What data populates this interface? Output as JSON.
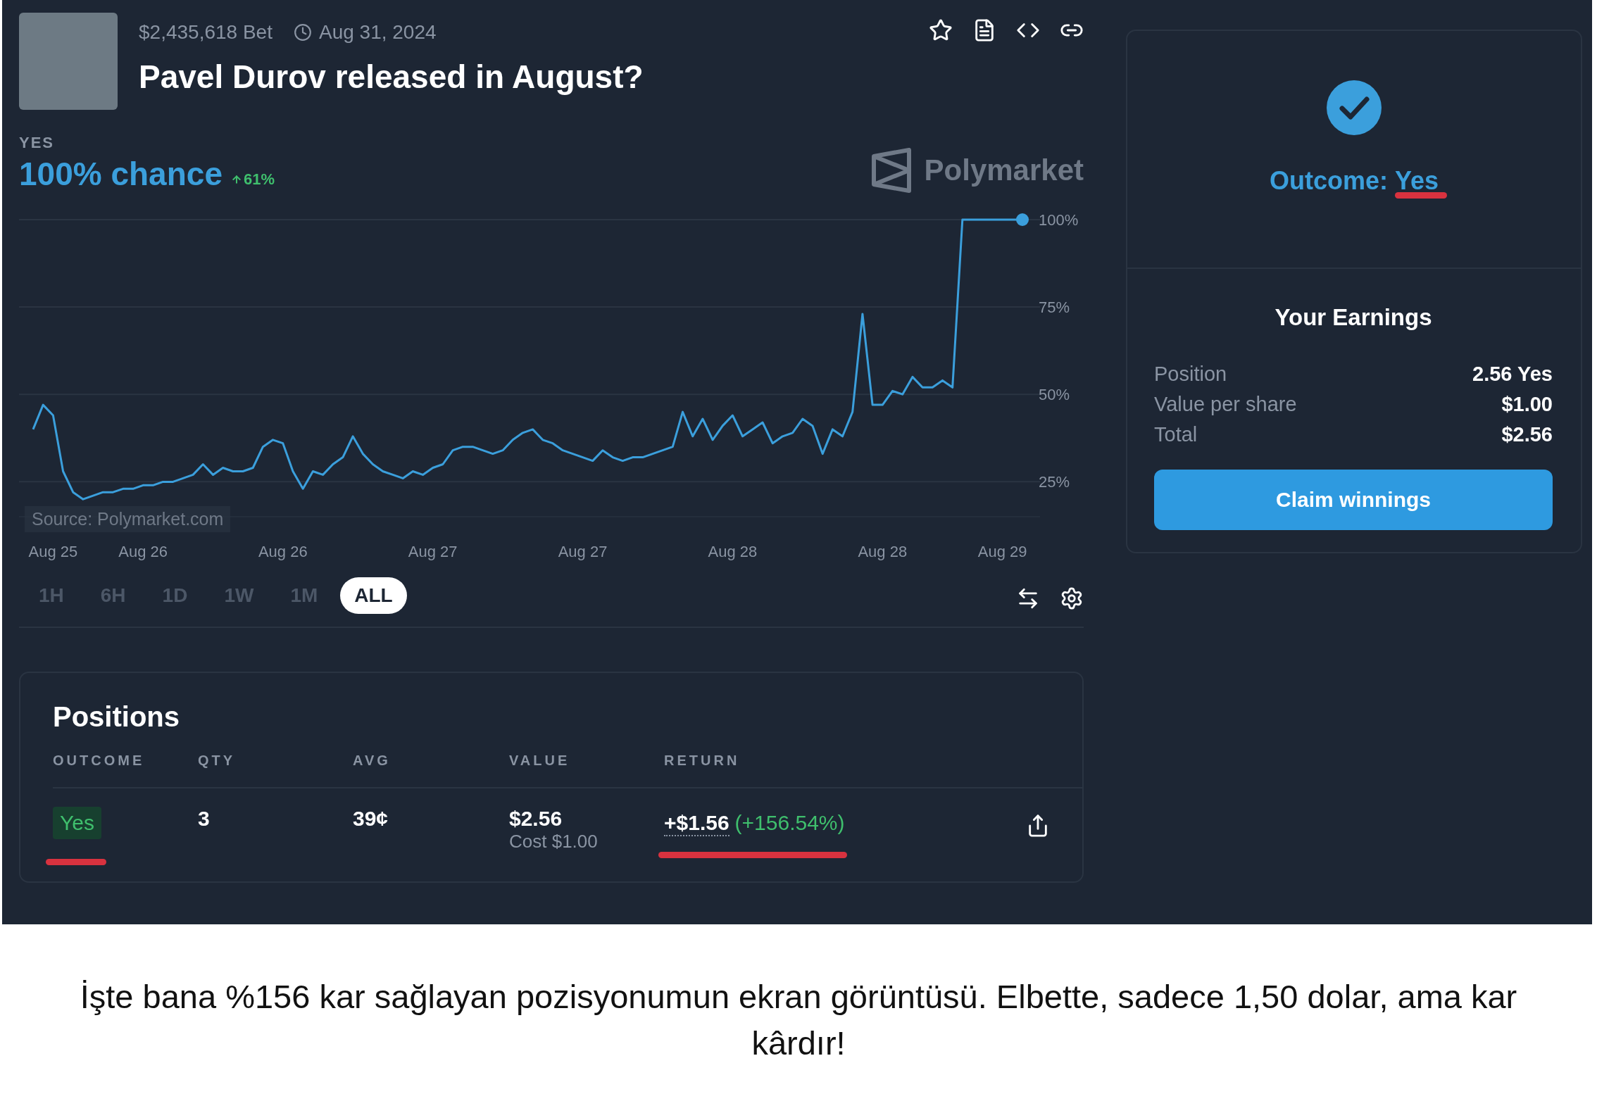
{
  "market": {
    "volume": "$2,435,618 Bet",
    "end_date": "Aug 31, 2024",
    "title": "Pavel Durov released in August?"
  },
  "probability": {
    "outcome_label": "YES",
    "chance": "100% chance",
    "change": "61%"
  },
  "brand": "Polymarket",
  "chart_source": "Source: Polymarket.com",
  "chart_data": {
    "type": "line",
    "grid": true,
    "ylim": [
      15,
      100
    ],
    "yticks": [
      {
        "value": 25,
        "label": "25%"
      },
      {
        "value": 50,
        "label": "50%"
      },
      {
        "value": 75,
        "label": "75%"
      },
      {
        "value": 100,
        "label": "100%"
      }
    ],
    "categories": [
      null,
      null,
      "Aug 25",
      null,
      null,
      null,
      null,
      null,
      null,
      null,
      null,
      "Aug 26",
      null,
      null,
      null,
      null,
      null,
      null,
      null,
      null,
      null,
      null,
      null,
      null,
      null,
      "Aug 26",
      null,
      null,
      null,
      null,
      null,
      null,
      null,
      null,
      null,
      null,
      null,
      null,
      null,
      null,
      "Aug 27",
      null,
      null,
      null,
      null,
      null,
      null,
      null,
      null,
      null,
      null,
      null,
      null,
      null,
      null,
      "Aug 27",
      null,
      null,
      null,
      null,
      null,
      null,
      null,
      null,
      null,
      null,
      null,
      null,
      null,
      null,
      "Aug 28",
      null,
      null,
      null,
      null,
      null,
      null,
      null,
      null,
      null,
      null,
      null,
      null,
      null,
      null,
      "Aug 28",
      null,
      null,
      null,
      null,
      null,
      null,
      null,
      null,
      null,
      null,
      null,
      "Aug 29",
      null,
      null
    ],
    "series": [
      {
        "color": "#3b9fdc",
        "values": [
          40,
          47,
          44,
          28,
          22,
          20,
          21,
          22,
          22,
          23,
          23,
          24,
          24,
          25,
          25,
          26,
          27,
          30,
          27,
          29,
          28,
          28,
          29,
          35,
          37,
          36,
          28,
          23,
          28,
          27,
          30,
          32,
          38,
          33,
          30,
          28,
          27,
          26,
          28,
          27,
          29,
          30,
          34,
          35,
          35,
          34,
          33,
          34,
          37,
          39,
          40,
          37,
          36,
          34,
          33,
          32,
          31,
          34,
          32,
          31,
          32,
          32,
          33,
          34,
          35,
          45,
          38,
          43,
          37,
          41,
          44,
          38,
          40,
          42,
          36,
          38,
          39,
          43,
          41,
          33,
          40,
          38,
          45,
          73,
          47,
          47,
          51,
          50,
          55,
          52,
          52,
          54,
          52,
          100,
          100,
          100,
          100,
          100,
          100,
          100
        ]
      }
    ]
  },
  "time_ranges": [
    {
      "label": "1H",
      "selected": false
    },
    {
      "label": "6H",
      "selected": false
    },
    {
      "label": "1D",
      "selected": false
    },
    {
      "label": "1W",
      "selected": false
    },
    {
      "label": "1M",
      "selected": false
    },
    {
      "label": "ALL",
      "selected": true
    }
  ],
  "positions": {
    "title": "Positions",
    "columns": [
      "OUTCOME",
      "QTY",
      "AVG",
      "VALUE",
      "RETURN"
    ],
    "rows": [
      {
        "outcome": "Yes",
        "qty": "3",
        "avg": "39¢",
        "value": "$2.56",
        "cost": "Cost $1.00",
        "return": "+$1.56",
        "return_pct": "(+156.54%)"
      }
    ]
  },
  "resolution": {
    "label": "Outcome:",
    "value": "Yes"
  },
  "earnings": {
    "title": "Your Earnings",
    "rows": [
      {
        "label": "Position",
        "value": "2.56 Yes"
      },
      {
        "label": "Value per share",
        "value": "$1.00"
      },
      {
        "label": "Total",
        "value": "$2.56"
      }
    ],
    "button": "Claim winnings"
  },
  "caption": "İşte bana %156 kar sağlayan pozisyonumun ekran görüntüsü. Elbette, sadece 1,50 dolar, ama kar kârdır!"
}
